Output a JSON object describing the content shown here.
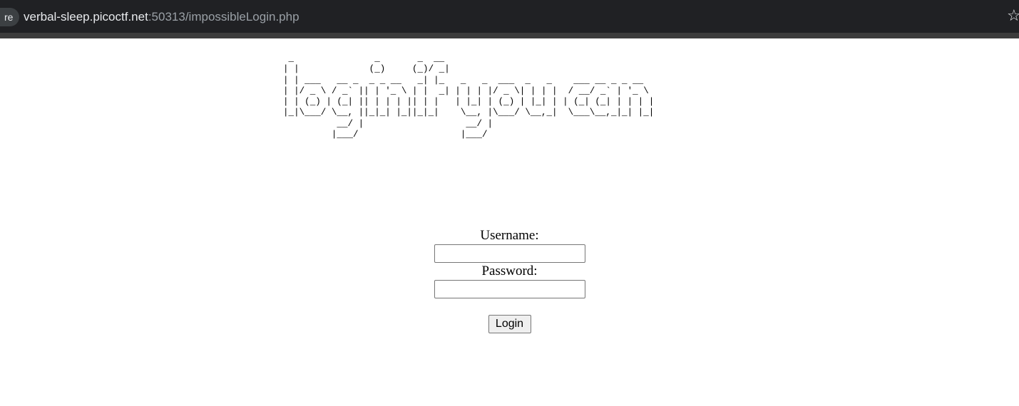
{
  "browser": {
    "security_chip": "re",
    "url_host": "verbal-sleep.picoctf.net",
    "url_path": ":50313/impossibleLogin.php",
    "bookmark_icon": "star-icon"
  },
  "page": {
    "ascii_banner": " _               _       _  __\n| |             (_)     (_)/ _|\n| | ___   __ _  _ _ __   _| |_   _   _  ___  _   _    ___ __ _ _ __\n| |/ _ \\ / _` || | '_ \\ | |  _| | | | |/ _ \\| | | |  / __/ _` | '_ \\\n| | (_) | (_| || | | | || | |   | |_| | (_) | |_| | | (_| (_| | | | |\n|_|\\___/ \\__, ||_|_| |_||_|_|    \\__, |\\___/ \\__,_|  \\___\\__,_|_| |_|\n          __/ |                   __/ |\n         |___/                   |___/",
    "username_label": "Username:",
    "username_value": "",
    "password_label": "Password:",
    "password_value": "",
    "login_button": "Login"
  }
}
